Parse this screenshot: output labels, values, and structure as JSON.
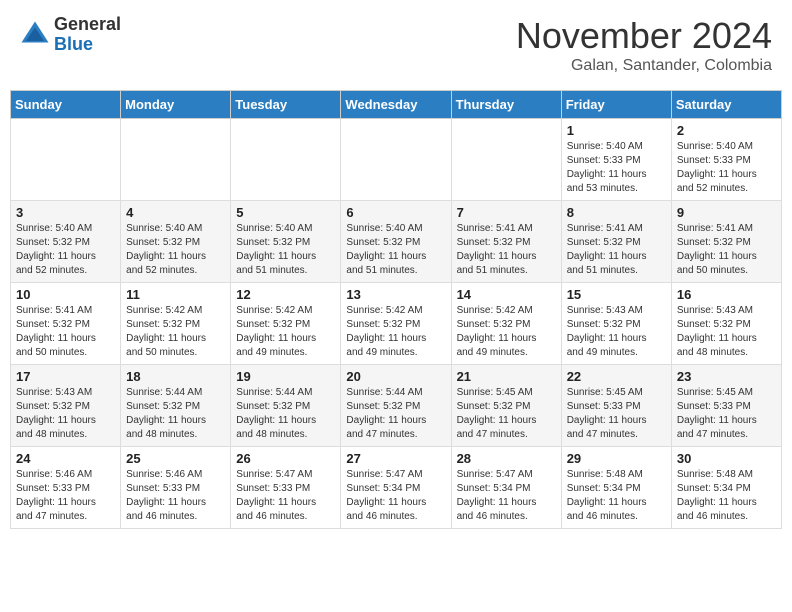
{
  "header": {
    "logo_general": "General",
    "logo_blue": "Blue",
    "month_title": "November 2024",
    "location": "Galan, Santander, Colombia"
  },
  "days_of_week": [
    "Sunday",
    "Monday",
    "Tuesday",
    "Wednesday",
    "Thursday",
    "Friday",
    "Saturday"
  ],
  "weeks": [
    [
      {
        "day": "",
        "info": ""
      },
      {
        "day": "",
        "info": ""
      },
      {
        "day": "",
        "info": ""
      },
      {
        "day": "",
        "info": ""
      },
      {
        "day": "",
        "info": ""
      },
      {
        "day": "1",
        "info": "Sunrise: 5:40 AM\nSunset: 5:33 PM\nDaylight: 11 hours and 53 minutes."
      },
      {
        "day": "2",
        "info": "Sunrise: 5:40 AM\nSunset: 5:33 PM\nDaylight: 11 hours and 52 minutes."
      }
    ],
    [
      {
        "day": "3",
        "info": "Sunrise: 5:40 AM\nSunset: 5:32 PM\nDaylight: 11 hours and 52 minutes."
      },
      {
        "day": "4",
        "info": "Sunrise: 5:40 AM\nSunset: 5:32 PM\nDaylight: 11 hours and 52 minutes."
      },
      {
        "day": "5",
        "info": "Sunrise: 5:40 AM\nSunset: 5:32 PM\nDaylight: 11 hours and 51 minutes."
      },
      {
        "day": "6",
        "info": "Sunrise: 5:40 AM\nSunset: 5:32 PM\nDaylight: 11 hours and 51 minutes."
      },
      {
        "day": "7",
        "info": "Sunrise: 5:41 AM\nSunset: 5:32 PM\nDaylight: 11 hours and 51 minutes."
      },
      {
        "day": "8",
        "info": "Sunrise: 5:41 AM\nSunset: 5:32 PM\nDaylight: 11 hours and 51 minutes."
      },
      {
        "day": "9",
        "info": "Sunrise: 5:41 AM\nSunset: 5:32 PM\nDaylight: 11 hours and 50 minutes."
      }
    ],
    [
      {
        "day": "10",
        "info": "Sunrise: 5:41 AM\nSunset: 5:32 PM\nDaylight: 11 hours and 50 minutes."
      },
      {
        "day": "11",
        "info": "Sunrise: 5:42 AM\nSunset: 5:32 PM\nDaylight: 11 hours and 50 minutes."
      },
      {
        "day": "12",
        "info": "Sunrise: 5:42 AM\nSunset: 5:32 PM\nDaylight: 11 hours and 49 minutes."
      },
      {
        "day": "13",
        "info": "Sunrise: 5:42 AM\nSunset: 5:32 PM\nDaylight: 11 hours and 49 minutes."
      },
      {
        "day": "14",
        "info": "Sunrise: 5:42 AM\nSunset: 5:32 PM\nDaylight: 11 hours and 49 minutes."
      },
      {
        "day": "15",
        "info": "Sunrise: 5:43 AM\nSunset: 5:32 PM\nDaylight: 11 hours and 49 minutes."
      },
      {
        "day": "16",
        "info": "Sunrise: 5:43 AM\nSunset: 5:32 PM\nDaylight: 11 hours and 48 minutes."
      }
    ],
    [
      {
        "day": "17",
        "info": "Sunrise: 5:43 AM\nSunset: 5:32 PM\nDaylight: 11 hours and 48 minutes."
      },
      {
        "day": "18",
        "info": "Sunrise: 5:44 AM\nSunset: 5:32 PM\nDaylight: 11 hours and 48 minutes."
      },
      {
        "day": "19",
        "info": "Sunrise: 5:44 AM\nSunset: 5:32 PM\nDaylight: 11 hours and 48 minutes."
      },
      {
        "day": "20",
        "info": "Sunrise: 5:44 AM\nSunset: 5:32 PM\nDaylight: 11 hours and 47 minutes."
      },
      {
        "day": "21",
        "info": "Sunrise: 5:45 AM\nSunset: 5:32 PM\nDaylight: 11 hours and 47 minutes."
      },
      {
        "day": "22",
        "info": "Sunrise: 5:45 AM\nSunset: 5:33 PM\nDaylight: 11 hours and 47 minutes."
      },
      {
        "day": "23",
        "info": "Sunrise: 5:45 AM\nSunset: 5:33 PM\nDaylight: 11 hours and 47 minutes."
      }
    ],
    [
      {
        "day": "24",
        "info": "Sunrise: 5:46 AM\nSunset: 5:33 PM\nDaylight: 11 hours and 47 minutes."
      },
      {
        "day": "25",
        "info": "Sunrise: 5:46 AM\nSunset: 5:33 PM\nDaylight: 11 hours and 46 minutes."
      },
      {
        "day": "26",
        "info": "Sunrise: 5:47 AM\nSunset: 5:33 PM\nDaylight: 11 hours and 46 minutes."
      },
      {
        "day": "27",
        "info": "Sunrise: 5:47 AM\nSunset: 5:34 PM\nDaylight: 11 hours and 46 minutes."
      },
      {
        "day": "28",
        "info": "Sunrise: 5:47 AM\nSunset: 5:34 PM\nDaylight: 11 hours and 46 minutes."
      },
      {
        "day": "29",
        "info": "Sunrise: 5:48 AM\nSunset: 5:34 PM\nDaylight: 11 hours and 46 minutes."
      },
      {
        "day": "30",
        "info": "Sunrise: 5:48 AM\nSunset: 5:34 PM\nDaylight: 11 hours and 46 minutes."
      }
    ]
  ]
}
